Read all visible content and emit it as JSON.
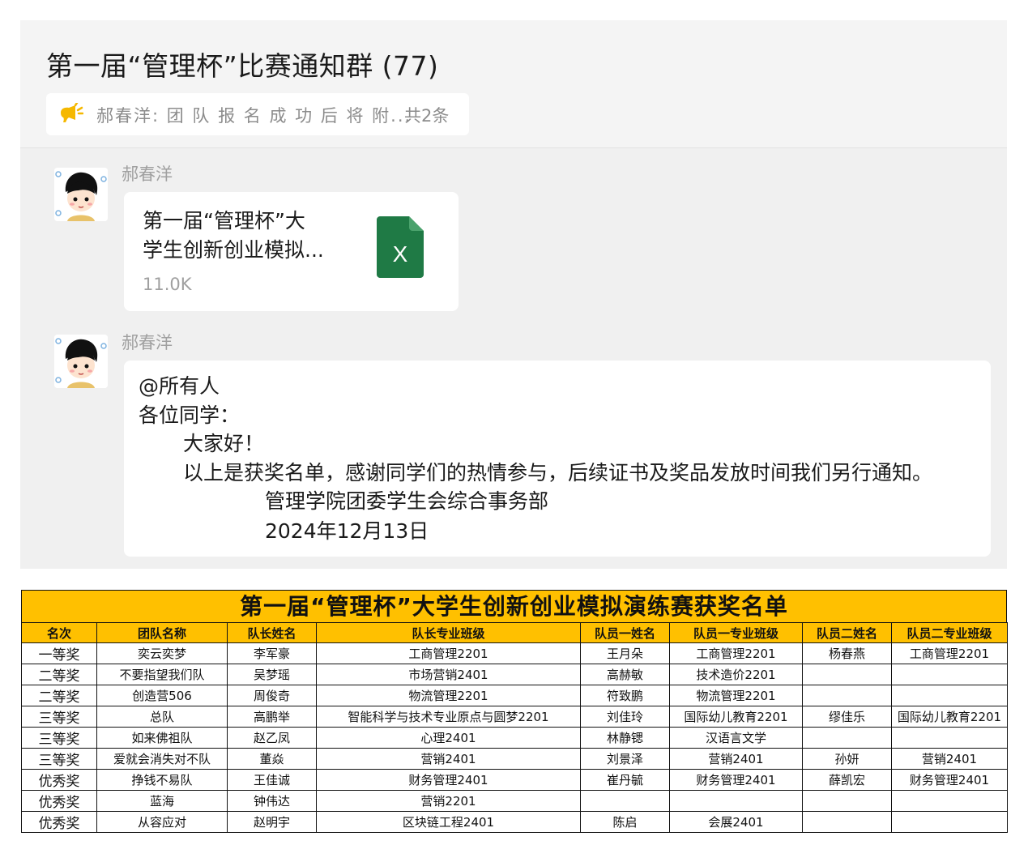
{
  "chat": {
    "group_title": "第一届“管理杯”比赛通知群 (77)",
    "notice": {
      "text": "郝春洋: 团 队 报 名 成 功 后 将 附...",
      "count": "共2条",
      "icon": "speaker-icon"
    },
    "messages": [
      {
        "sender": "郝春洋",
        "type": "file",
        "file_name_line1": "第一届“管理杯”大",
        "file_name_line2": "学生创新创业模拟...",
        "file_size": "11.0K",
        "file_icon": "excel-icon",
        "file_icon_letter": "X"
      },
      {
        "sender": "郝春洋",
        "type": "text",
        "lines": [
          "@所有人",
          "各位同学：",
          "大家好！",
          "以上是获奖名单，感谢同学们的热情参与，后续证书及奖品发放时间我们另行通知。",
          "管理学院团委学生会综合事务部",
          "2024年12月13日"
        ]
      }
    ]
  },
  "award_table": {
    "title": "第一届“管理杯”大学生创新创业模拟演练赛获奖名单",
    "header_color": "#ffc000",
    "columns": [
      "名次",
      "团队名称",
      "队长姓名",
      "队长专业班级",
      "队员一姓名",
      "队员一专业班级",
      "队员二姓名",
      "队员二专业班级"
    ],
    "rows": [
      [
        "一等奖",
        "奕云奕梦",
        "李军豪",
        "工商管理2201",
        "王月朵",
        "工商管理2201",
        "杨春燕",
        "工商管理2201"
      ],
      [
        "二等奖",
        "不要指望我们队",
        "吴梦瑶",
        "市场营销2401",
        "高赫敏",
        "技术造价2201",
        "",
        ""
      ],
      [
        "二等奖",
        "创造营506",
        "周俊奇",
        "物流管理2201",
        "符致鹏",
        "物流管理2201",
        "",
        ""
      ],
      [
        "三等奖",
        "总队",
        "高鹏举",
        "智能科学与技术专业原点与圆梦2201",
        "刘佳玲",
        "国际幼儿教育2201",
        "缪佳乐",
        "国际幼儿教育2201"
      ],
      [
        "三等奖",
        "如来佛祖队",
        "赵乙凤",
        "心理2401",
        "林静锶",
        "汉语言文学",
        "",
        ""
      ],
      [
        "三等奖",
        "爱就会消失对不队",
        "董焱",
        "营销2401",
        "刘景泽",
        "营销2401",
        "孙妍",
        "营销2401"
      ],
      [
        "优秀奖",
        "挣钱不易队",
        "王佳诚",
        "财务管理2401",
        "崔丹毓",
        "财务管理2401",
        "薛凯宏",
        "财务管理2401"
      ],
      [
        "优秀奖",
        "蓝海",
        "钟伟达",
        "营销2201",
        "",
        "",
        "",
        ""
      ],
      [
        "优秀奖",
        "从容应对",
        "赵明宇",
        "区块链工程2401",
        "陈启",
        "会展2401",
        "",
        ""
      ]
    ]
  }
}
